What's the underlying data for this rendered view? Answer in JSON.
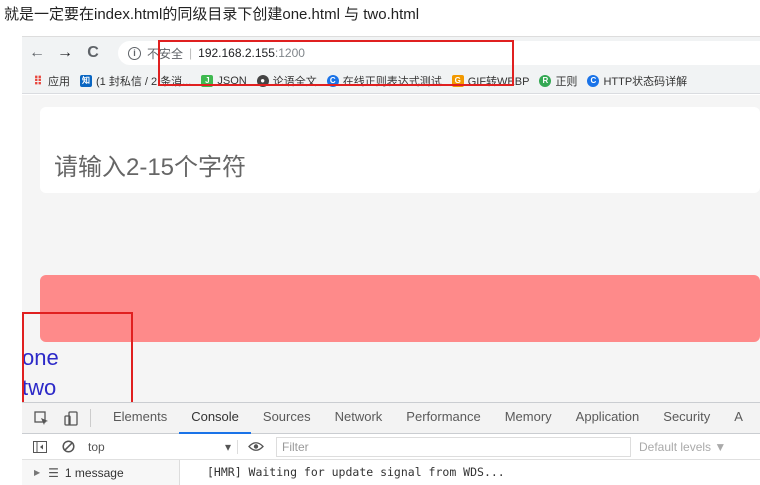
{
  "caption": "就是一定要在index.html的同级目录下创建one.html 与 two.html",
  "browser": {
    "back_icon": "←",
    "forward_icon": "→",
    "reload_icon": "C",
    "security_label": "不安全",
    "url_host": "192.168.2.155",
    "url_port": ":1200"
  },
  "bookmarks": [
    {
      "label": "应用",
      "icon": "apps-icon",
      "color": "#e8453c"
    },
    {
      "label": "(1 封私信 / 2 条消...",
      "icon": "zhihu-icon",
      "color": "#0a66c2"
    },
    {
      "label": "JSON",
      "icon": "json-icon",
      "color": "#3fb950"
    },
    {
      "label": "论语全文",
      "icon": "globe-icon",
      "color": "#444444"
    },
    {
      "label": "在线正则表达式测试",
      "icon": "c-icon",
      "color": "#1a73e8"
    },
    {
      "label": "GIF转WEBP",
      "icon": "gif-icon",
      "color": "#f29900"
    },
    {
      "label": "正则",
      "icon": "reg-icon",
      "color": "#34a853"
    },
    {
      "label": "HTTP状态码详解",
      "icon": "c-icon",
      "color": "#1a73e8"
    }
  ],
  "page": {
    "input_placeholder": "请输入2-15个字符",
    "link_one": "one",
    "link_two": "two"
  },
  "devtools": {
    "tabs": [
      "Elements",
      "Console",
      "Sources",
      "Network",
      "Performance",
      "Memory",
      "Application",
      "Security",
      "A"
    ],
    "active_tab": "Console",
    "context": "top",
    "filter_placeholder": "Filter",
    "levels": "Default levels ▼",
    "messages_label": "1 message",
    "log": "[HMR] Waiting for update signal from WDS..."
  },
  "colors": {
    "red_bar": "#fe8a8a",
    "annotation": "#e02020",
    "link": "#2c29c8"
  }
}
